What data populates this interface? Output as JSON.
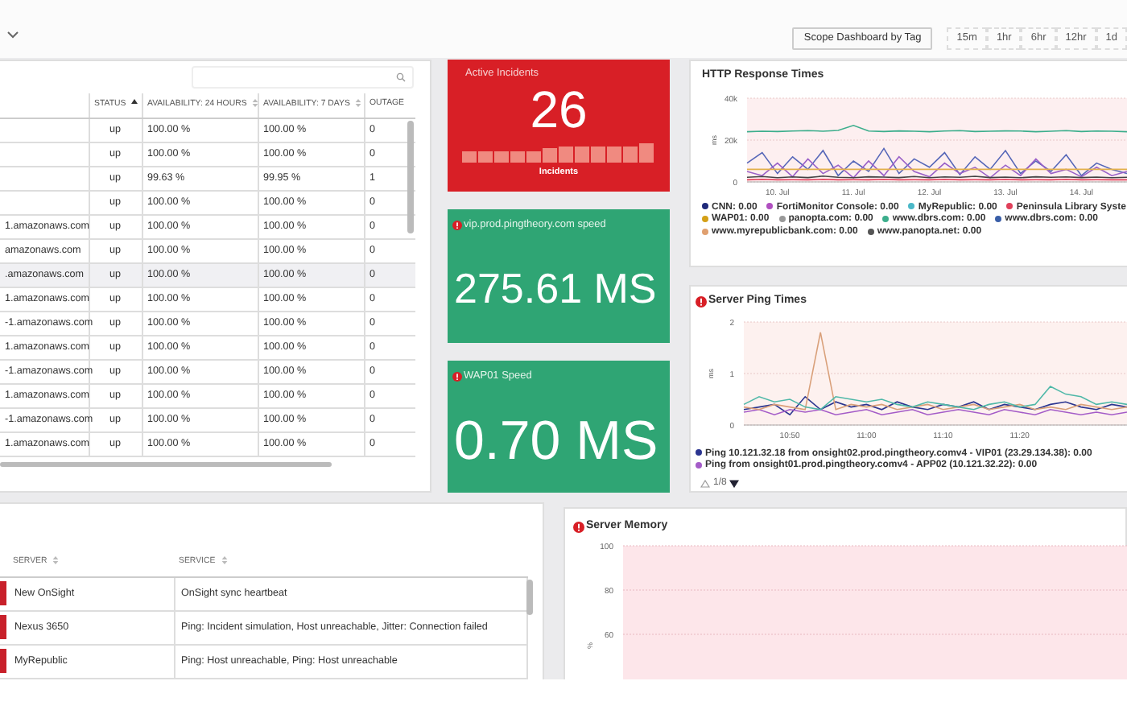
{
  "toolbar": {
    "scope_button": "Scope Dashboard by Tag",
    "time_ranges": [
      "15m",
      "1hr",
      "6hr",
      "12hr",
      "1d"
    ]
  },
  "uptime_table": {
    "columns": [
      {
        "label": "STATUS",
        "sorted": true
      },
      {
        "label": "AVAILABILITY: 24 HOURS",
        "sorted": false
      },
      {
        "label": "AVAILABILITY: 7 DAYS",
        "sorted": false
      },
      {
        "label": "OUTAGE"
      }
    ],
    "rows": [
      {
        "status": "up",
        "availability_24h": "100.00 %",
        "availability_7d": "100.00 %",
        "outages": "0",
        "selected": false
      },
      {
        "status": "up",
        "availability_24h": "100.00 %",
        "availability_7d": "100.00 %",
        "outages": "0",
        "selected": false
      },
      {
        "status": "up",
        "availability_24h": "99.63 %",
        "availability_7d": "99.95 %",
        "outages": "1",
        "selected": false
      },
      {
        "status": "up",
        "availability_24h": "100.00 %",
        "availability_7d": "100.00 %",
        "outages": "0",
        "selected": false
      },
      {
        "host": "1.amazonaws.com",
        "status": "up",
        "availability_24h": "100.00 %",
        "availability_7d": "100.00 %",
        "outages": "0",
        "selected": false
      },
      {
        "host": "amazonaws.com",
        "status": "up",
        "availability_24h": "100.00 %",
        "availability_7d": "100.00 %",
        "outages": "0",
        "selected": false
      },
      {
        "host": ".amazonaws.com",
        "status": "up",
        "availability_24h": "100.00 %",
        "availability_7d": "100.00 %",
        "outages": "0",
        "selected": true
      },
      {
        "host": "1.amazonaws.com",
        "status": "up",
        "availability_24h": "100.00 %",
        "availability_7d": "100.00 %",
        "outages": "0",
        "selected": false
      },
      {
        "host": "-1.amazonaws.com",
        "status": "up",
        "availability_24h": "100.00 %",
        "availability_7d": "100.00 %",
        "outages": "0",
        "selected": false
      },
      {
        "host": "1.amazonaws.com",
        "status": "up",
        "availability_24h": "100.00 %",
        "availability_7d": "100.00 %",
        "outages": "0",
        "selected": false
      },
      {
        "host": "-1.amazonaws.com",
        "status": "up",
        "availability_24h": "100.00 %",
        "availability_7d": "100.00 %",
        "outages": "0",
        "selected": false
      },
      {
        "host": "1.amazonaws.com",
        "status": "up",
        "availability_24h": "100.00 %",
        "availability_7d": "100.00 %",
        "outages": "0",
        "selected": false
      },
      {
        "host": "-1.amazonaws.com",
        "status": "up",
        "availability_24h": "100.00 %",
        "availability_7d": "100.00 %",
        "outages": "0",
        "selected": false
      },
      {
        "host": "1.amazonaws.com",
        "status": "up",
        "availability_24h": "100.00 %",
        "availability_7d": "100.00 %",
        "outages": "0",
        "selected": false
      }
    ]
  },
  "stat_cards": [
    {
      "kind": "incidents",
      "title": "Active Incidents",
      "value": "26",
      "caption": "Incidents",
      "color": "#d81f26"
    },
    {
      "kind": "metric",
      "title": "vip.prod.pingtheory.com speed",
      "value": "275.61 MS",
      "alert": true,
      "color": "#2fa574"
    },
    {
      "kind": "metric",
      "title": "WAP01 Speed",
      "value": "0.70 MS",
      "alert": true,
      "color": "#2fa574"
    }
  ],
  "http_chart": {
    "title": "HTTP Response Times",
    "alert": false,
    "chart_data": {
      "type": "line",
      "ylabel": "ms",
      "ylim": [
        0,
        40000
      ],
      "yticks": [
        {
          "value": 0,
          "label": "0"
        },
        {
          "value": 20000,
          "label": "20k"
        },
        {
          "value": 40000,
          "label": "40k"
        }
      ],
      "categories": [
        null,
        null,
        "10. Jul",
        null,
        null,
        null,
        null,
        "11. Jul",
        null,
        null,
        null,
        null,
        "12. Jul",
        null,
        null,
        null,
        null,
        "13. Jul",
        null,
        null,
        null,
        null,
        "14. Jul",
        null,
        null,
        null
      ],
      "series": [
        {
          "color": "#3cae8c",
          "values": [
            24000,
            24200,
            24100,
            24300,
            24500,
            24200,
            24600,
            27000,
            24300,
            24100,
            24400,
            24200,
            24000,
            24300,
            24500,
            24100,
            24200,
            24400,
            24300,
            24000,
            24200,
            24500,
            24100,
            24300,
            24200,
            24000
          ]
        },
        {
          "color": "#5566b8",
          "values": [
            9000,
            14000,
            4000,
            12000,
            6000,
            15000,
            3000,
            10000,
            5000,
            16000,
            4000,
            11000,
            7000,
            14000,
            3500,
            12000,
            6000,
            15000,
            4000,
            10000,
            5000,
            13000,
            3000,
            9000,
            6000,
            4000
          ]
        },
        {
          "color": "#9a60c8",
          "values": [
            5000,
            3000,
            9000,
            2500,
            11000,
            4000,
            8000,
            2000,
            10000,
            3000,
            12000,
            5000,
            2500,
            9000,
            4000,
            7000,
            2000,
            8000,
            3000,
            11000,
            4000,
            6000,
            2500,
            7000,
            3000,
            5000
          ]
        },
        {
          "color": "#e3b04b",
          "values": [
            6000,
            6000,
            6000,
            6000,
            6000,
            6000,
            6000,
            6000,
            6000,
            6000,
            6000,
            6000,
            6000,
            6000,
            6000,
            6000,
            6000,
            6000,
            6000,
            6000,
            6000,
            6000,
            6000,
            6000,
            6000,
            6000
          ]
        },
        {
          "color": "#e0405a",
          "values": [
            1000,
            1200,
            1000,
            1100,
            1000,
            1200,
            1000,
            1100,
            1000,
            1200,
            1000,
            1100,
            1000,
            1200,
            1000,
            1100,
            1000,
            1200,
            1000,
            1100,
            1000,
            1200,
            1000,
            1100,
            1000,
            1000
          ]
        },
        {
          "color": "#444444",
          "values": [
            2200,
            2600,
            2000,
            2400,
            2100,
            2800,
            2200,
            2000,
            2500,
            2300,
            2100,
            2600,
            2000,
            2400,
            2200,
            2700,
            2100,
            2300,
            2000,
            2500,
            2200,
            2400,
            2100,
            2300,
            2000,
            2200
          ]
        }
      ]
    },
    "legend": [
      {
        "label": "CNN: 0.00",
        "color": "#1f2a7a"
      },
      {
        "label": "FortiMonitor Console: 0.00",
        "color": "#b04fc0"
      },
      {
        "label": "MyRepublic: 0.00",
        "color": "#4bb8c8"
      },
      {
        "label": "Peninsula Library Syste",
        "color": "#e0405a"
      },
      {
        "label": "WAP01: 0.00",
        "color": "#d4a017"
      },
      {
        "label": "panopta.com: 0.00",
        "color": "#999999"
      },
      {
        "label": "www.dbrs.com: 0.00",
        "color": "#3cae8c"
      },
      {
        "label": "www.dbrs.com: 0.00",
        "color": "#3a5fa8"
      },
      {
        "label": "www.myrepublicbank.com: 0.00",
        "color": "#e0a070"
      },
      {
        "label": "www.panopta.net: 0.00",
        "color": "#555555"
      }
    ]
  },
  "ping_chart": {
    "title": "Server Ping Times",
    "alert": true,
    "chart_data": {
      "type": "line",
      "ylabel": "ms",
      "ylim": [
        0,
        2
      ],
      "yticks": [
        0,
        1,
        2
      ],
      "categories": [
        null,
        null,
        null,
        "10:50",
        null,
        null,
        null,
        null,
        "11:00",
        null,
        null,
        null,
        null,
        "11:10",
        null,
        null,
        null,
        null,
        "11:20",
        null,
        null,
        null,
        null,
        null,
        null,
        null
      ],
      "series": [
        {
          "color": "#2b3590",
          "values": [
            0.3,
            0.35,
            0.4,
            0.2,
            0.55,
            0.3,
            0.45,
            0.35,
            0.4,
            0.3,
            0.45,
            0.35,
            0.3,
            0.4,
            0.35,
            0.45,
            0.3,
            0.4,
            0.35,
            0.3,
            0.4,
            0.45,
            0.35,
            0.3,
            0.4,
            0.35
          ]
        },
        {
          "color": "#a45cc8",
          "values": [
            0.25,
            0.3,
            0.2,
            0.3,
            0.25,
            0.3,
            0.2,
            0.25,
            0.3,
            0.2,
            0.25,
            0.3,
            0.2,
            0.25,
            0.3,
            0.25,
            0.2,
            0.3,
            0.25,
            0.2,
            0.3,
            0.25,
            0.2,
            0.25,
            0.2,
            0.25
          ]
        },
        {
          "color": "#d9a07a",
          "values": [
            0.35,
            0.3,
            0.4,
            0.35,
            0.3,
            1.8,
            0.3,
            0.4,
            0.35,
            0.4,
            0.3,
            0.35,
            0.4,
            0.3,
            0.35,
            0.4,
            0.3,
            0.35,
            0.4,
            0.3,
            0.35,
            0.3,
            0.4,
            0.35,
            0.3,
            0.35
          ]
        },
        {
          "color": "#4fb8a8",
          "values": [
            0.4,
            0.55,
            0.45,
            0.5,
            0.35,
            0.3,
            0.55,
            0.5,
            0.45,
            0.5,
            0.4,
            0.35,
            0.45,
            0.4,
            0.35,
            0.3,
            0.4,
            0.45,
            0.35,
            0.4,
            0.75,
            0.6,
            0.55,
            0.4,
            0.45,
            0.4
          ]
        }
      ]
    },
    "legend": [
      {
        "label": "Ping 10.121.32.18 from onsight02.prod.pingtheory.comv4 - VIP01 (23.29.134.38): 0.00",
        "color": "#2b3590"
      },
      {
        "label": "Ping from onsight01.prod.pingtheory.comv4 - APP02 (10.121.32.22): 0.00",
        "color": "#a45cc8"
      }
    ],
    "pager": {
      "text": "1/8",
      "up_disabled": true,
      "down_disabled": false
    }
  },
  "incidents_table": {
    "columns": [
      {
        "label": "SERVER"
      },
      {
        "label": "SERVICE"
      }
    ],
    "rows": [
      {
        "server": "New OnSight",
        "service": "OnSight sync heartbeat",
        "color": "#c8202a"
      },
      {
        "server": "Nexus 3650",
        "service": "Ping: Incident simulation, Host unreachable, Jitter: Connection failed",
        "color": "#c8202a"
      },
      {
        "server": "MyRepublic",
        "service": "Ping: Host unreachable, Ping: Host unreachable",
        "color": "#c8202a"
      }
    ]
  },
  "memory_chart": {
    "title": "Server Memory",
    "alert": true,
    "axis_labels": [
      "100",
      "80",
      "60"
    ],
    "axis_title": "%"
  }
}
